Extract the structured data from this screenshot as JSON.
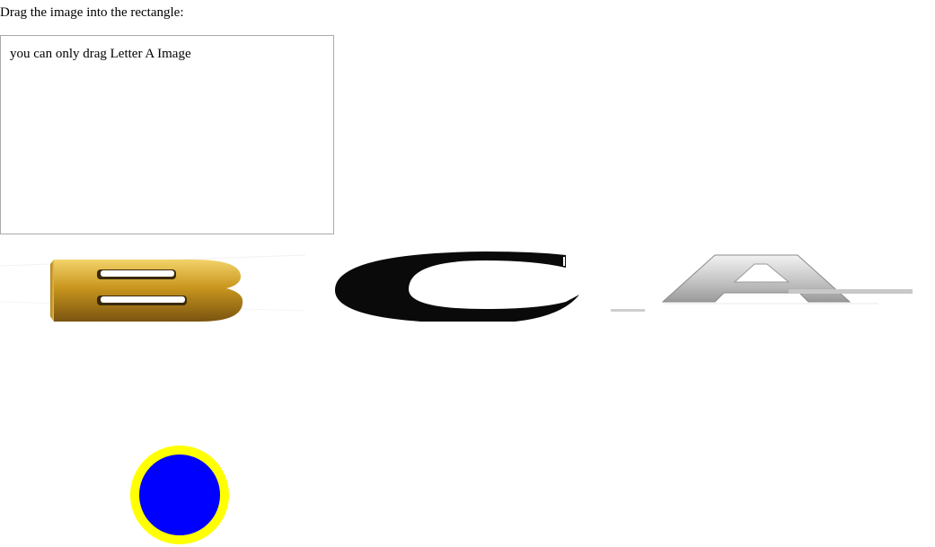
{
  "page": {
    "instruction": "Drag the image into the rectangle:"
  },
  "drop_zone": {
    "hint": "you can only drag Letter A Image"
  },
  "images": [
    {
      "letter": "B",
      "style": "gold 3D letter"
    },
    {
      "letter": "C",
      "style": "black letter"
    },
    {
      "letter": "A",
      "style": "silver 3D letter"
    }
  ],
  "colors": {
    "drop_zone_border": "#aaaaaa",
    "gold": "#c9961e",
    "circle_fill": "#0000ff",
    "circle_stroke": "#ffff00",
    "silver": "#c8c8c8"
  }
}
